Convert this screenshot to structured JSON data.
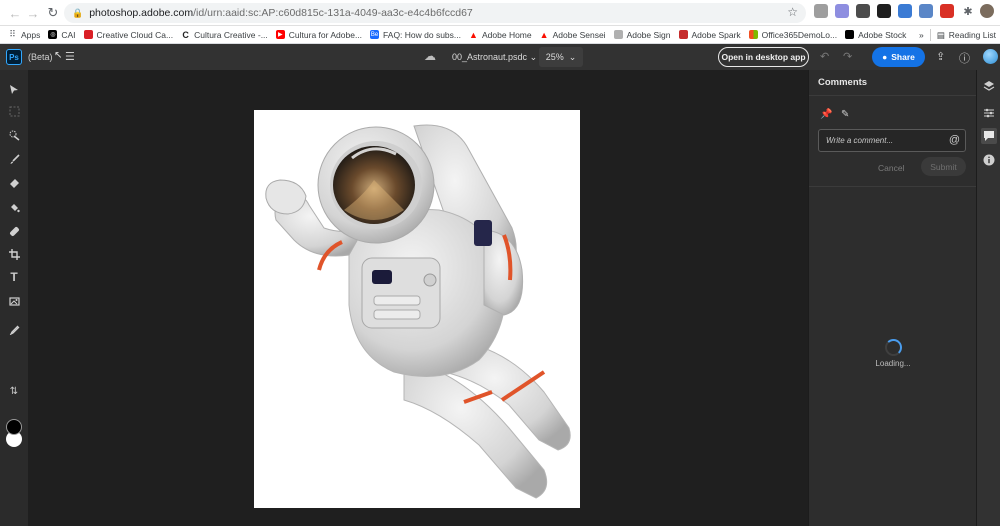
{
  "browser": {
    "url_host": "photoshop.adobe.com",
    "url_path": "/id/urn:aaid:sc:AP:c60d815c-131a-4049-aa3c-e4c4b6fccd67",
    "bookmarks": [
      {
        "label": "Apps",
        "color": "#5f6368"
      },
      {
        "label": "CAI",
        "color": "#000000"
      },
      {
        "label": "Creative Cloud Ca...",
        "color": "#da1f26"
      },
      {
        "label": "Cultura Creative -...",
        "color": "#222222"
      },
      {
        "label": "Cultura for Adobe...",
        "color": "#ff0000"
      },
      {
        "label": "FAQ: How do subs...",
        "color": "#1769ff"
      },
      {
        "label": "Adobe Home",
        "color": "#fa0f00"
      },
      {
        "label": "Adobe Sensei",
        "color": "#fa0f00"
      },
      {
        "label": "Adobe Sign",
        "color": "#999999"
      },
      {
        "label": "Adobe Spark",
        "color": "#ff3366"
      },
      {
        "label": "Office365DemoLo...",
        "color": "#f25022"
      },
      {
        "label": "Adobe Stock",
        "color": "#000000"
      }
    ],
    "more_label": "»",
    "reading_list": "Reading List"
  },
  "app": {
    "logo": "Ps",
    "beta_label": "(Beta)",
    "doc_name": "00_Astronaut.psdc",
    "zoom": "25%",
    "open_desktop_label": "Open in desktop app",
    "share_label": "Share",
    "accent": "#1473e6"
  },
  "tools": [
    {
      "name": "move-tool-icon",
      "glyph": "➤"
    },
    {
      "name": "marquee-tool-icon",
      "glyph": "⬚"
    },
    {
      "name": "quick-select-tool-icon",
      "glyph": "✎"
    },
    {
      "name": "brush-tool-icon",
      "glyph": "🖌"
    },
    {
      "name": "eraser-tool-icon",
      "glyph": "⌫"
    },
    {
      "name": "paint-bucket-tool-icon",
      "glyph": "◆"
    },
    {
      "name": "healing-tool-icon",
      "glyph": "✚"
    },
    {
      "name": "crop-tool-icon",
      "glyph": "⌗"
    },
    {
      "name": "type-tool-icon",
      "glyph": "T"
    },
    {
      "name": "place-image-tool-icon",
      "glyph": "▣"
    },
    {
      "name": "eyedropper-tool-icon",
      "glyph": "✐"
    }
  ],
  "comments": {
    "title": "Comments",
    "placeholder": "Write a comment...",
    "cancel_label": "Cancel",
    "submit_label": "Submit",
    "loading_label": "Loading..."
  }
}
